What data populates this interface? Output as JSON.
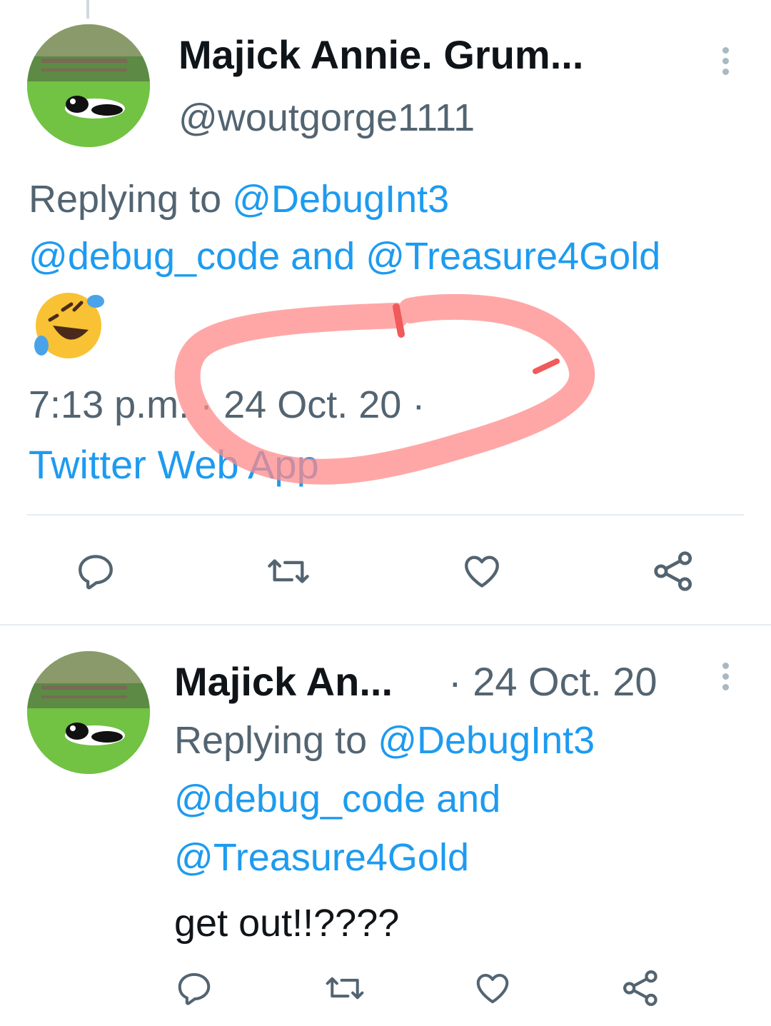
{
  "tweet_main": {
    "display_name": "Majick Annie. Grum...",
    "handle": "@woutgorge1111",
    "replying_prefix": "Replying to",
    "reply_to_1": "@DebugInt3",
    "reply_to_2": "@debug_code",
    "reply_and": "and",
    "reply_to_3": "@Treasure4Gold",
    "emoji": "🤣",
    "time": "7:13 p.m.",
    "sep": "·",
    "date": "24 Oct. 20",
    "source": "Twitter Web App"
  },
  "tweet_reply": {
    "display_name": "Majick An...",
    "date": "· 24 Oct. 20",
    "replying_prefix": "Replying to",
    "reply_to_1": "@DebugInt3",
    "reply_to_2": "@debug_code",
    "reply_and": "and",
    "reply_to_3": "@Treasure4Gold",
    "body": "get out!!????"
  },
  "icons": [
    "reply-icon",
    "retweet-icon",
    "like-icon",
    "share-icon",
    "more-icon"
  ],
  "colors": {
    "link": "#1d9bf0",
    "muted": "#536471",
    "icon": "#536471",
    "annotation": "#ff8a8a"
  }
}
